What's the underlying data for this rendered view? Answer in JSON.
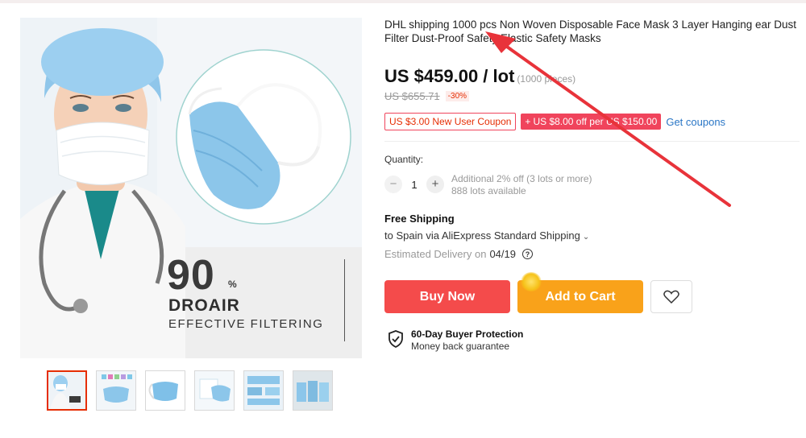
{
  "product": {
    "title": "DHL shipping 1000 pcs Non Woven Disposable Face Mask 3 Layer Hanging ear Dust Filter Dust-Proof Safety Elastic Safety Masks",
    "price": "US $459.00 / lot",
    "price_unit": "(1000 pieces)",
    "old_price": "US $655.71",
    "discount": "-30%"
  },
  "gallery": {
    "promo_number": "90",
    "promo_percent": "%",
    "promo_title": "DROAIR",
    "promo_subtitle": "EFFECTIVE FILTERING",
    "thumbnails_count": 6
  },
  "coupons": {
    "new_user": "US $3.00 New User Coupon",
    "store_plus": "+",
    "store": "US $8.00 off per US $150.00",
    "link": "Get coupons"
  },
  "quantity": {
    "label": "Quantity:",
    "minus": "−",
    "value": "1",
    "plus": "+",
    "note_line1": "Additional 2% off (3 lots or more)",
    "note_line2": "888 lots available"
  },
  "shipping": {
    "title": "Free Shipping",
    "line": "to Spain via AliExpress Standard Shipping",
    "delivery_label": "Estimated Delivery on",
    "delivery_date": "04/19",
    "help": "?"
  },
  "actions": {
    "buy_now": "Buy Now",
    "add_to_cart": "Add to Cart"
  },
  "protection": {
    "title": "60-Day Buyer Protection",
    "subtitle": "Money back guarantee"
  },
  "colors": {
    "buy_now": "#f44b4b",
    "add_to_cart": "#f9a21a",
    "coupon": "#f0445c",
    "link": "#2a76c6",
    "annotation_arrow": "#e8333a"
  }
}
